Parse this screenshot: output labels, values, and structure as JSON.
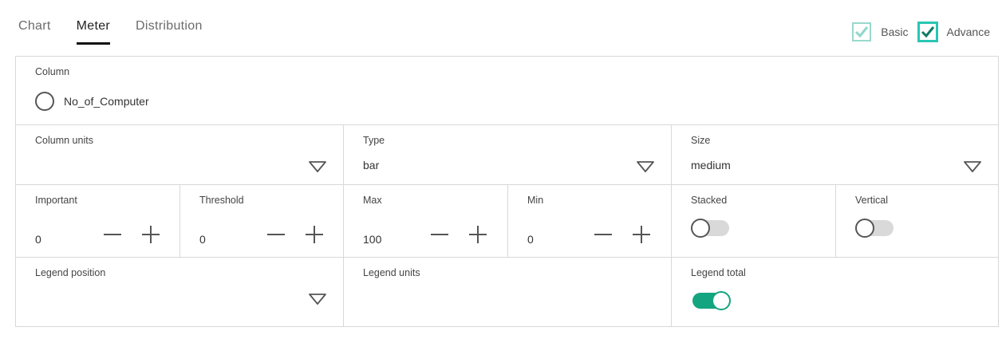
{
  "tabs": [
    {
      "label": "Chart",
      "active": false
    },
    {
      "label": "Meter",
      "active": true
    },
    {
      "label": "Distribution",
      "active": false
    }
  ],
  "views": {
    "basic": {
      "label": "Basic",
      "checked": true
    },
    "advance": {
      "label": "Advance",
      "checked": true
    }
  },
  "form": {
    "column": {
      "label": "Column",
      "option": "No_of_Computer",
      "selected": false
    },
    "column_units": {
      "label": "Column units",
      "value": ""
    },
    "type": {
      "label": "Type",
      "value": "bar"
    },
    "size": {
      "label": "Size",
      "value": "medium"
    },
    "important": {
      "label": "Important",
      "value": "0"
    },
    "threshold": {
      "label": "Threshold",
      "value": "0"
    },
    "max": {
      "label": "Max",
      "value": "100"
    },
    "min": {
      "label": "Min",
      "value": "0"
    },
    "stacked": {
      "label": "Stacked",
      "on": false
    },
    "vertical": {
      "label": "Vertical",
      "on": false
    },
    "legend_position": {
      "label": "Legend position",
      "value": ""
    },
    "legend_units": {
      "label": "Legend units",
      "value": ""
    },
    "legend_total": {
      "label": "Legend total",
      "on": true
    }
  },
  "colors": {
    "accent": "#29c6b3",
    "toggle_on": "#13a57f",
    "border": "#d8d8d8"
  }
}
